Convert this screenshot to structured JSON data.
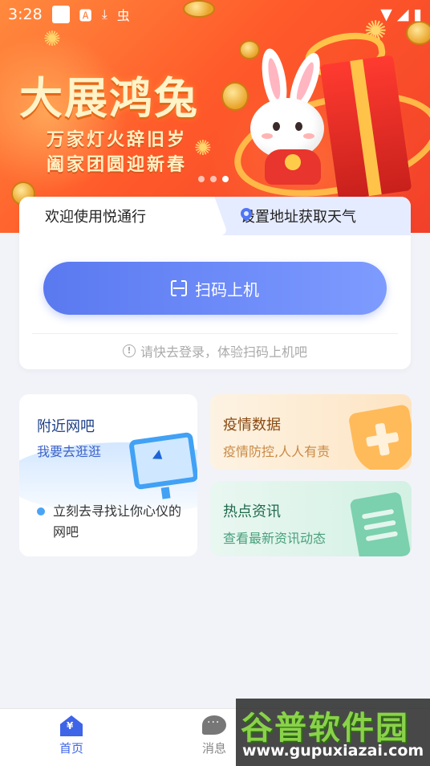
{
  "status_bar": {
    "time": "3:28",
    "left_icons": [
      "white-square-icon",
      "font-icon",
      "download-icon",
      "bug-icon"
    ],
    "right_icons": [
      "wifi-icon",
      "signal-icon",
      "battery-icon"
    ]
  },
  "banner": {
    "title": "大展鸿兔",
    "subtitle_line1": "万家灯火辞旧岁",
    "subtitle_line2": "阖家团圆迎新春",
    "page_count": 3,
    "active_page": 3
  },
  "welcome_card": {
    "welcome_text": "欢迎使用悦通行",
    "weather_text": "设置地址获取天气",
    "scan_button": "扫码上机",
    "hint": "请快去登录，体验扫码上机吧"
  },
  "features": {
    "nearby": {
      "title": "附近网吧",
      "subtitle": "我要去逛逛",
      "description": "立刻去寻找让你心仪的网吧"
    },
    "epidemic": {
      "title": "疫情数据",
      "subtitle": "疫情防控,人人有责"
    },
    "news": {
      "title": "热点资讯",
      "subtitle": "查看最新资讯动态"
    }
  },
  "bottom_nav": {
    "home": "首页",
    "messages": "消息"
  },
  "watermark": {
    "main": "谷普软件园",
    "url": "www.gupuxiazai.com"
  },
  "colors": {
    "primary": "#5a79f0",
    "banner": "#ff5a2a",
    "background": "#f2f3f8"
  }
}
